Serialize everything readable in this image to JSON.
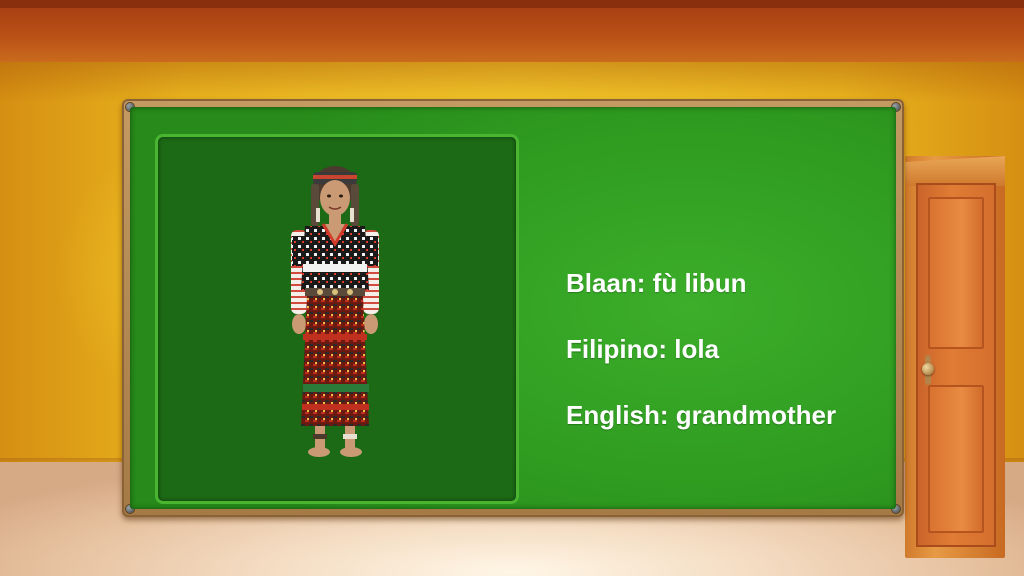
{
  "scene": {
    "colors": {
      "board_green": "#2f9b20",
      "panel_green": "#1c6a16",
      "frame_brown": "#a57a45",
      "wall_yellow": "#f3c92c",
      "door_orange": "#e07c34"
    }
  },
  "illustration": {
    "icon": "woman-in-traditional-blaan-attire"
  },
  "words": {
    "blaan": "Blaan: fù libun",
    "filipino": "Filipino: lola",
    "english": "English: grandmother"
  }
}
